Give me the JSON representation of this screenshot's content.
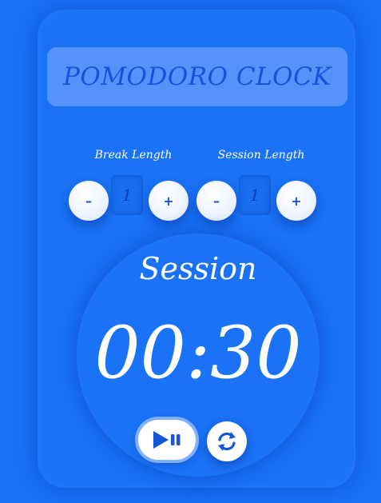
{
  "app": {
    "title": "POMODORO CLOCK"
  },
  "break": {
    "label": "Break Length",
    "value": "1",
    "decrement_label": "–",
    "increment_label": "+"
  },
  "session": {
    "label": "Session Length",
    "value": "1",
    "decrement_label": "–",
    "increment_label": "+"
  },
  "timer": {
    "mode_label": "Session",
    "time": "00:30"
  },
  "controls": {
    "play_pause_icon": "play-pause-icon",
    "reset_icon": "refresh-icon"
  },
  "colors": {
    "background": "#1a72f6",
    "title_box": "#5593fb",
    "title_text": "#1553dc",
    "accent_dark": "#1656d9"
  }
}
